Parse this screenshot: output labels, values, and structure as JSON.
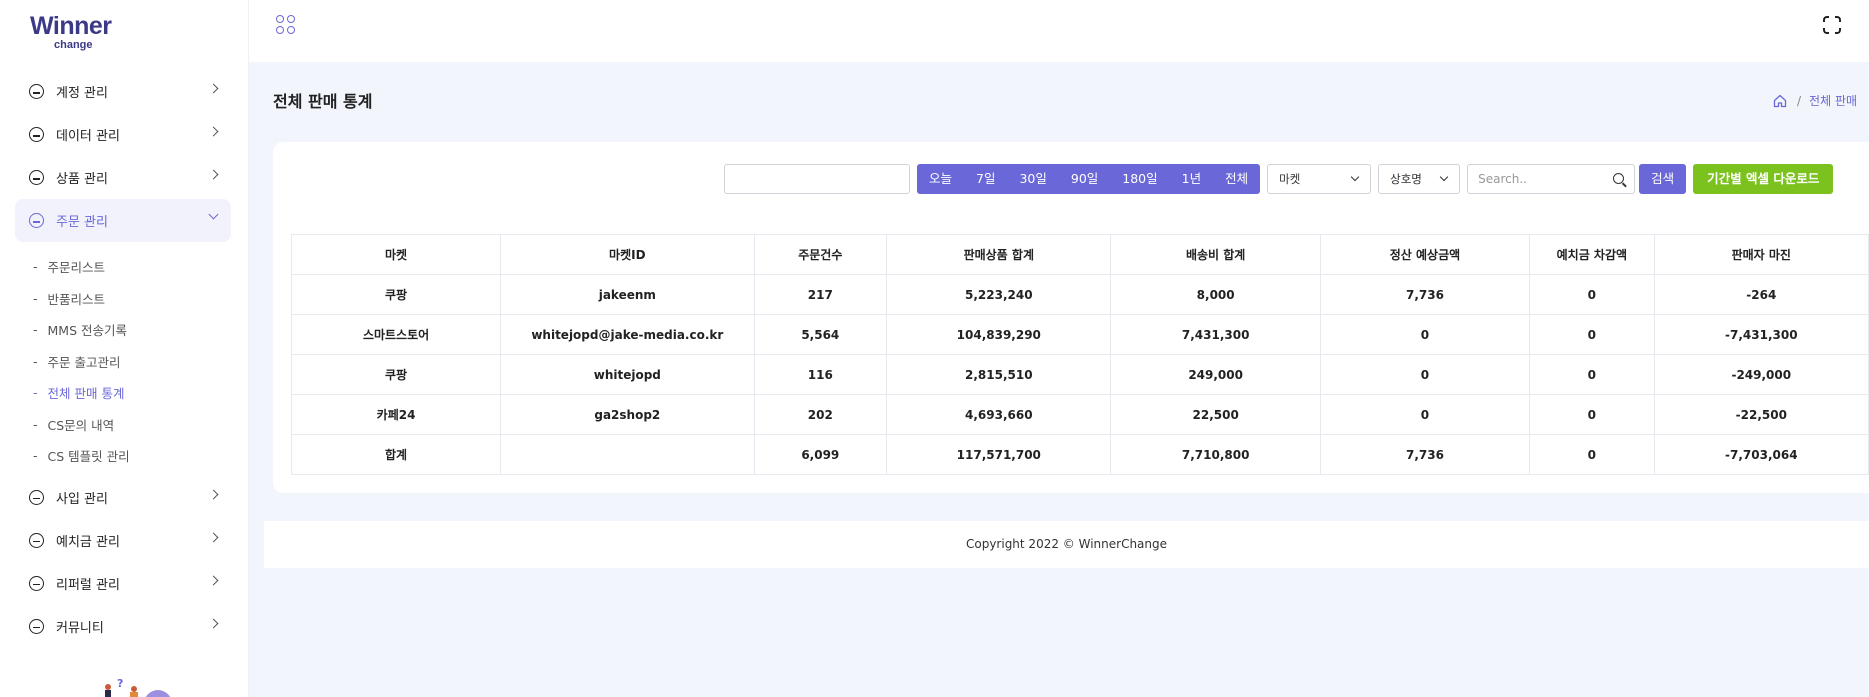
{
  "logo": {
    "main": "Winner",
    "sub": "change"
  },
  "sidebar": {
    "items_top": [
      {
        "label": "계정 관리"
      },
      {
        "label": "데이터 관리"
      },
      {
        "label": "상품 관리"
      },
      {
        "label": "주문 관리"
      }
    ],
    "sub_items": [
      {
        "label": "주문리스트"
      },
      {
        "label": "반품리스트"
      },
      {
        "label": "MMS 전송기록"
      },
      {
        "label": "주문 출고관리"
      },
      {
        "label": "전체 판매 통계"
      },
      {
        "label": "CS문의 내역"
      },
      {
        "label": "CS 템플릿 관리"
      }
    ],
    "items_bottom": [
      {
        "label": "사입 관리"
      },
      {
        "label": "예치금 관리"
      },
      {
        "label": "리퍼럴 관리"
      },
      {
        "label": "커뮤니티"
      }
    ],
    "dash": "-"
  },
  "page": {
    "title": "전체 판매 통계",
    "breadcrumb_sep": "/",
    "breadcrumb_current": "전체 판매"
  },
  "filters": {
    "date_value": "",
    "ranges": [
      "오늘",
      "7일",
      "30일",
      "90일",
      "180일",
      "1년",
      "전체"
    ],
    "market_select": "마켓",
    "company_select": "상호명",
    "search_placeholder": "Search..",
    "search_button": "검색",
    "excel_button": "기간별 엑셀 다운로드"
  },
  "table": {
    "headers": [
      "마켓",
      "마켓ID",
      "주문건수",
      "판매상품 합계",
      "배송비 합계",
      "정산 예상금액",
      "예치금 차감액",
      "판매자 마진"
    ],
    "rows": [
      [
        "쿠팡",
        "jakeenm",
        "217",
        "5,223,240",
        "8,000",
        "7,736",
        "0",
        "-264"
      ],
      [
        "스마트스토어",
        "whitejopd@jake-media.co.kr",
        "5,564",
        "104,839,290",
        "7,431,300",
        "0",
        "0",
        "-7,431,300"
      ],
      [
        "쿠팡",
        "whitejopd",
        "116",
        "2,815,510",
        "249,000",
        "0",
        "0",
        "-249,000"
      ],
      [
        "카페24",
        "ga2shop2",
        "202",
        "4,693,660",
        "22,500",
        "0",
        "0",
        "-22,500"
      ],
      [
        "합계",
        "",
        "6,099",
        "117,571,700",
        "7,710,800",
        "7,736",
        "0",
        "-7,703,064"
      ]
    ]
  },
  "footer": {
    "copyright": "Copyright 2022 © WinnerChange"
  },
  "colors": {
    "accent": "#6a68d8",
    "excel": "#7cc21f",
    "background": "#f2f5fb"
  }
}
